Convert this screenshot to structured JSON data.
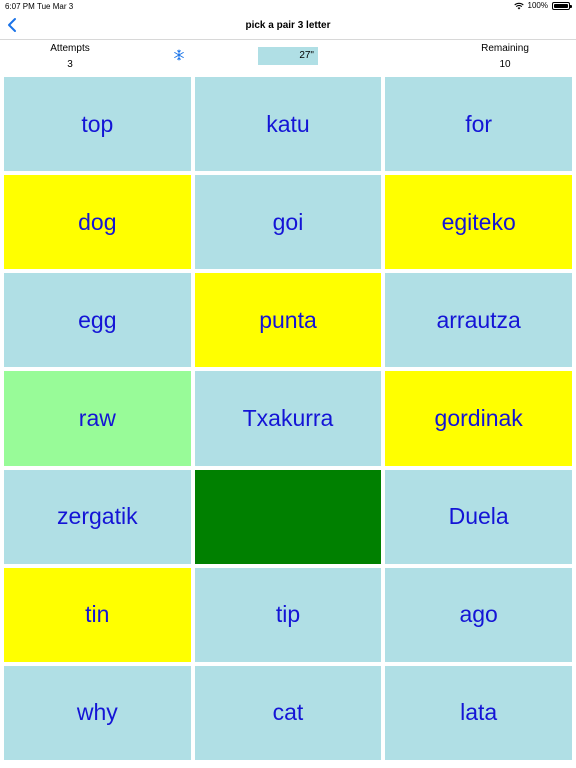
{
  "status_bar": {
    "time": "6:07 PM",
    "date": "Tue Mar 3",
    "battery": "100%"
  },
  "nav": {
    "title": "pick a pair 3 letter",
    "back_icon": "chevron-left-icon",
    "accent": "#1a73e8"
  },
  "info": {
    "attempts_label": "Attempts",
    "attempts_value": "3",
    "remaining_label": "Remaining",
    "remaining_value": "10",
    "timer": "27\"",
    "snow_icon": "snowflake-icon"
  },
  "colors": {
    "default": "#b0dfe5",
    "selected": "#ffff00",
    "matched": "#98fb98",
    "hidden": "#008000",
    "text": "#1414d6"
  },
  "tiles": [
    {
      "label": "top",
      "state": "default"
    },
    {
      "label": "katu",
      "state": "default"
    },
    {
      "label": "for",
      "state": "default"
    },
    {
      "label": "dog",
      "state": "selected"
    },
    {
      "label": "goi",
      "state": "default"
    },
    {
      "label": "egiteko",
      "state": "selected"
    },
    {
      "label": "egg",
      "state": "default"
    },
    {
      "label": "punta",
      "state": "selected"
    },
    {
      "label": "arrautza",
      "state": "default"
    },
    {
      "label": "raw",
      "state": "matched"
    },
    {
      "label": "Txakurra",
      "state": "default"
    },
    {
      "label": "gordinak",
      "state": "selected"
    },
    {
      "label": "zergatik",
      "state": "default"
    },
    {
      "label": "",
      "state": "hidden"
    },
    {
      "label": "Duela",
      "state": "default"
    },
    {
      "label": "tin",
      "state": "selected"
    },
    {
      "label": "tip",
      "state": "default"
    },
    {
      "label": "ago",
      "state": "default"
    },
    {
      "label": "why",
      "state": "default"
    },
    {
      "label": "cat",
      "state": "default"
    },
    {
      "label": "lata",
      "state": "default"
    }
  ]
}
